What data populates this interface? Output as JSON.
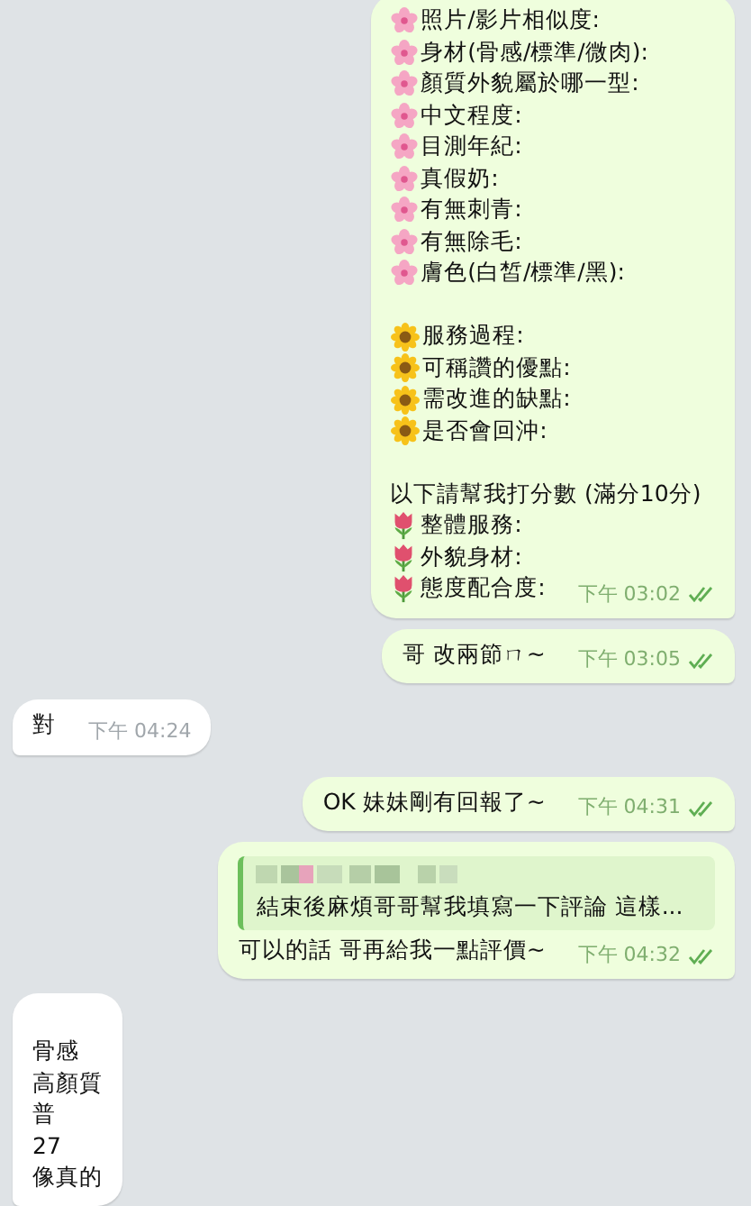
{
  "messages": [
    {
      "outgoing": true,
      "time": "下午 03:02",
      "read": true,
      "lines": [
        {
          "kind": "blossom",
          "text": "照片/影片相似度:"
        },
        {
          "kind": "blossom",
          "text": "身材(骨感/標準/微肉):"
        },
        {
          "kind": "blossom",
          "text": "顏質外貌屬於哪一型:"
        },
        {
          "kind": "blossom",
          "text": "中文程度:"
        },
        {
          "kind": "blossom",
          "text": "目測年紀:"
        },
        {
          "kind": "blossom",
          "text": "真假奶:"
        },
        {
          "kind": "blossom",
          "text": "有無刺青:"
        },
        {
          "kind": "blossom",
          "text": "有無除毛:"
        },
        {
          "kind": "blossom",
          "text": "膚色(白皙/標準/黑):"
        },
        {
          "kind": "blank"
        },
        {
          "kind": "sunflower",
          "text": "服務過程:"
        },
        {
          "kind": "sunflower",
          "text": "可稱讚的優點:"
        },
        {
          "kind": "sunflower",
          "text": "需改進的缺點:"
        },
        {
          "kind": "sunflower",
          "text": "是否會回沖:"
        },
        {
          "kind": "blank"
        },
        {
          "kind": "plain",
          "text": "以下請幫我打分數 (滿分10分)"
        },
        {
          "kind": "tulip",
          "text": "整體服務:"
        },
        {
          "kind": "tulip",
          "text": "外貌身材:"
        },
        {
          "kind": "tulip",
          "text": "態度配合度:"
        }
      ]
    },
    {
      "outgoing": true,
      "time": "下午 03:05",
      "read": true,
      "lines": [
        {
          "kind": "plain",
          "text": "哥 改兩節ㄇ~"
        }
      ]
    },
    {
      "outgoing": false,
      "time": "下午 04:24",
      "lines": [
        {
          "kind": "plain",
          "text": "對"
        }
      ]
    },
    {
      "outgoing": true,
      "time": "下午 04:31",
      "read": true,
      "lines": [
        {
          "kind": "plain",
          "text": "OK 妹妹剛有回報了~"
        }
      ]
    },
    {
      "outgoing": true,
      "time": "下午 04:32",
      "read": true,
      "quote": {
        "text": "結束後麻煩哥哥幫我填寫一下評論 這樣..."
      },
      "lines": [
        {
          "kind": "plain",
          "text": "可以的話 哥再給我一點評價~"
        }
      ]
    },
    {
      "outgoing": false,
      "lines": [
        {
          "kind": "blank"
        },
        {
          "kind": "plain",
          "text": "骨感"
        },
        {
          "kind": "plain",
          "text": "高顏質"
        },
        {
          "kind": "plain",
          "text": "普"
        },
        {
          "kind": "plain",
          "text": "27"
        },
        {
          "kind": "plain",
          "text": "像真的"
        }
      ]
    }
  ]
}
